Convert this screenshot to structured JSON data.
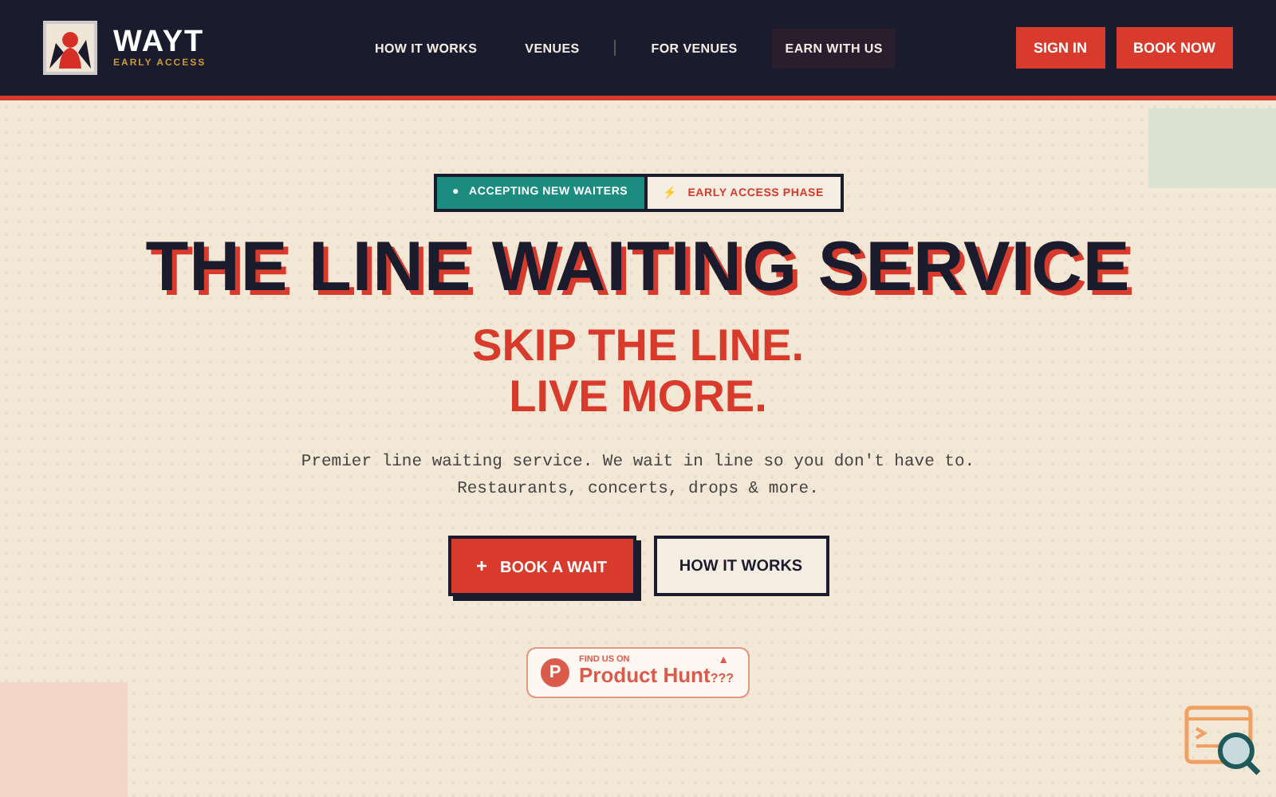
{
  "header": {
    "brand": "WAYT",
    "tagline": "EARLY ACCESS",
    "nav": [
      {
        "label": "HOW IT WORKS",
        "selected": false,
        "divider_after": false
      },
      {
        "label": "VENUES",
        "selected": false,
        "divider_after": true
      },
      {
        "label": "FOR VENUES",
        "selected": false,
        "divider_after": false
      },
      {
        "label": "EARN WITH US",
        "selected": true,
        "divider_after": false
      }
    ],
    "buttons": [
      "SIGN IN",
      "BOOK NOW"
    ]
  },
  "hero": {
    "badges": [
      {
        "kind": "status",
        "icon": "●",
        "label": "ACCEPTING NEW WAITERS"
      },
      {
        "kind": "phase",
        "icon": "⚡",
        "label": "EARLY ACCESS PHASE"
      }
    ],
    "title": "THE LINE WAITING SERVICE",
    "subtitle_lines": [
      "SKIP THE LINE.",
      "LIVE MORE."
    ],
    "description_lines": [
      "Premier line waiting service. We wait in line so you don't have to.",
      "Restaurants, concerts, drops & more."
    ],
    "actions": [
      {
        "kind": "primary",
        "icon": "+",
        "label": "BOOK A WAIT"
      },
      {
        "kind": "secondary",
        "label": "HOW IT WORKS"
      }
    ],
    "product_hunt": {
      "small": "FIND US ON",
      "name": "Product Hunt",
      "suffix": "???",
      "logo": "P",
      "arrow": "▲"
    }
  }
}
